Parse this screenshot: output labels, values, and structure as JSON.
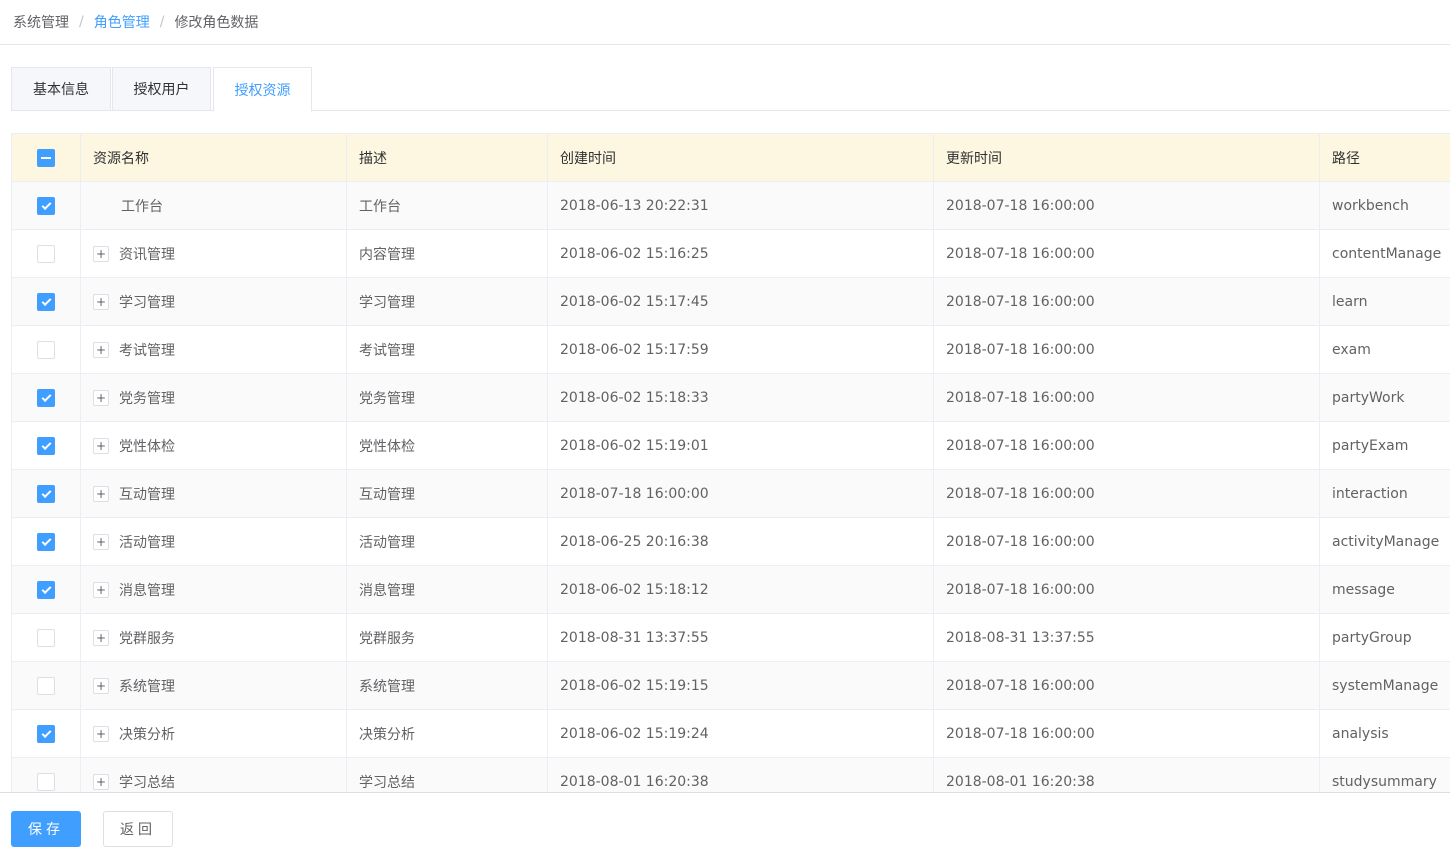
{
  "breadcrumb": {
    "items": [
      "系统管理",
      "角色管理",
      "修改角色数据"
    ],
    "separator": "/"
  },
  "tabs": [
    {
      "label": "基本信息",
      "active": false
    },
    {
      "label": "授权用户",
      "active": false
    },
    {
      "label": "授权资源",
      "active": true
    }
  ],
  "table": {
    "header_checkbox_state": "indeterminate",
    "columns": [
      "资源名称",
      "描述",
      "创建时间",
      "更新时间",
      "路径"
    ],
    "rows": [
      {
        "checked": true,
        "expandable": false,
        "expand_symbol": "+",
        "name": "工作台",
        "desc": "工作台",
        "created": "2018-06-13 20:22:31",
        "updated": "2018-07-18 16:00:00",
        "path": "workbench"
      },
      {
        "checked": false,
        "expandable": true,
        "expand_symbol": "+",
        "name": "资讯管理",
        "desc": "内容管理",
        "created": "2018-06-02 15:16:25",
        "updated": "2018-07-18 16:00:00",
        "path": "contentManage"
      },
      {
        "checked": true,
        "expandable": true,
        "expand_symbol": "+",
        "name": "学习管理",
        "desc": "学习管理",
        "created": "2018-06-02 15:17:45",
        "updated": "2018-07-18 16:00:00",
        "path": "learn"
      },
      {
        "checked": false,
        "expandable": true,
        "expand_symbol": "+",
        "name": "考试管理",
        "desc": "考试管理",
        "created": "2018-06-02 15:17:59",
        "updated": "2018-07-18 16:00:00",
        "path": "exam"
      },
      {
        "checked": true,
        "expandable": true,
        "expand_symbol": "+",
        "name": "党务管理",
        "desc": "党务管理",
        "created": "2018-06-02 15:18:33",
        "updated": "2018-07-18 16:00:00",
        "path": "partyWork"
      },
      {
        "checked": true,
        "expandable": true,
        "expand_symbol": "+",
        "name": "党性体检",
        "desc": "党性体检",
        "created": "2018-06-02 15:19:01",
        "updated": "2018-07-18 16:00:00",
        "path": "partyExam"
      },
      {
        "checked": true,
        "expandable": true,
        "expand_symbol": "+",
        "name": "互动管理",
        "desc": "互动管理",
        "created": "2018-07-18 16:00:00",
        "updated": "2018-07-18 16:00:00",
        "path": "interaction"
      },
      {
        "checked": true,
        "expandable": true,
        "expand_symbol": "+",
        "name": "活动管理",
        "desc": "活动管理",
        "created": "2018-06-25 20:16:38",
        "updated": "2018-07-18 16:00:00",
        "path": "activityManage"
      },
      {
        "checked": true,
        "expandable": true,
        "expand_symbol": "+",
        "name": "消息管理",
        "desc": "消息管理",
        "created": "2018-06-02 15:18:12",
        "updated": "2018-07-18 16:00:00",
        "path": "message"
      },
      {
        "checked": false,
        "expandable": true,
        "expand_symbol": "+",
        "name": "党群服务",
        "desc": "党群服务",
        "created": "2018-08-31 13:37:55",
        "updated": "2018-08-31 13:37:55",
        "path": "partyGroup"
      },
      {
        "checked": false,
        "expandable": true,
        "expand_symbol": "+",
        "name": "系统管理",
        "desc": "系统管理",
        "created": "2018-06-02 15:19:15",
        "updated": "2018-07-18 16:00:00",
        "path": "systemManage"
      },
      {
        "checked": true,
        "expandable": true,
        "expand_symbol": "+",
        "name": "决策分析",
        "desc": "决策分析",
        "created": "2018-06-02 15:19:24",
        "updated": "2018-07-18 16:00:00",
        "path": "analysis"
      },
      {
        "checked": false,
        "expandable": true,
        "expand_symbol": "+",
        "name": "学习总结",
        "desc": "学习总结",
        "created": "2018-08-01 16:20:38",
        "updated": "2018-08-01 16:20:38",
        "path": "studysummary"
      }
    ]
  },
  "footer": {
    "save_label": "保存",
    "back_label": "返回"
  },
  "colors": {
    "accent": "#409eff",
    "header_bg": "#fdf6e0",
    "border": "#ebeef5"
  }
}
